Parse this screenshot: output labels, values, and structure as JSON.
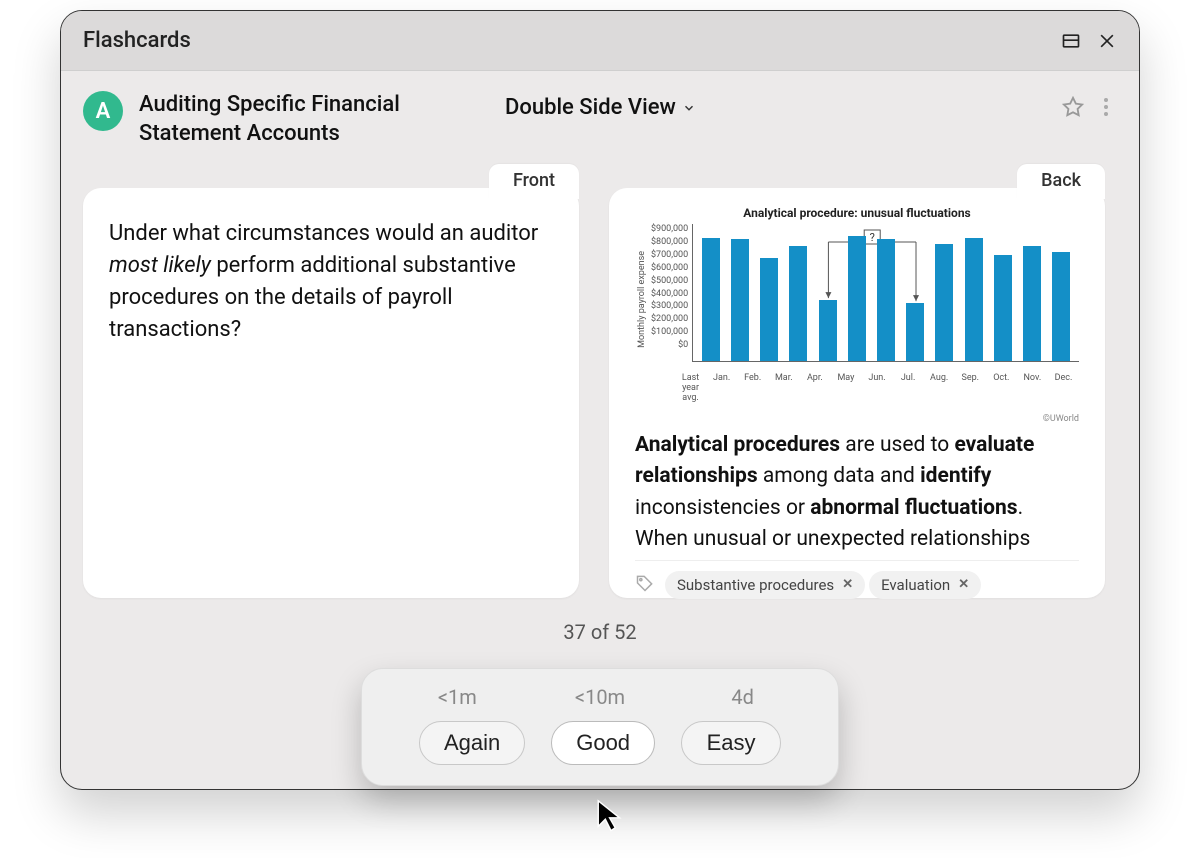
{
  "window": {
    "title": "Flashcards"
  },
  "deck": {
    "avatar_letter": "A",
    "title": "Auditing Specific Financial Statement Accounts"
  },
  "view_selector": {
    "label": "Double Side View"
  },
  "front": {
    "tab": "Front",
    "text_before_em": "Under what circumstances would an auditor ",
    "text_em": "most likely",
    "text_after_em": " perform additional substantive procedures on the details of payroll transactions?"
  },
  "back": {
    "tab": "Back",
    "paragraph_parts": [
      "Analytical procedures",
      " are used to ",
      "evaluate relationships",
      " among data and ",
      "identify",
      " inconsistencies or ",
      "abnormal fluctuations",
      ". When unusual or unexpected relationships"
    ],
    "attribution": "©UWorld"
  },
  "tags": {
    "items": [
      "Substantive procedures",
      "Evaluation"
    ]
  },
  "counter": {
    "text": "37 of 52"
  },
  "rating": {
    "times": [
      "<1m",
      "<10m",
      "4d"
    ],
    "again": "Again",
    "good": "Good",
    "easy": "Easy"
  },
  "chart_data": {
    "type": "bar",
    "title": "Analytical procedure: unusual fluctuations",
    "ylabel": "Monthly payroll expense",
    "ylim": [
      0,
      900000
    ],
    "yticks": [
      "$900,000",
      "$800,000",
      "$700,000",
      "$600,000",
      "$500,000",
      "$400,000",
      "$300,000",
      "$200,000",
      "$100,000",
      "$0"
    ],
    "categories": [
      "Last year avg.",
      "Jan.",
      "Feb.",
      "Mar.",
      "Apr.",
      "May",
      "Jun.",
      "Jul.",
      "Aug.",
      "Sep.",
      "Oct.",
      "Nov.",
      "Dec."
    ],
    "values": [
      810000,
      800000,
      680000,
      760000,
      400000,
      820000,
      800000,
      380000,
      770000,
      810000,
      700000,
      760000,
      720000
    ],
    "annotation_marker": "?",
    "annotation_targets": [
      "Apr.",
      "Jul."
    ]
  }
}
